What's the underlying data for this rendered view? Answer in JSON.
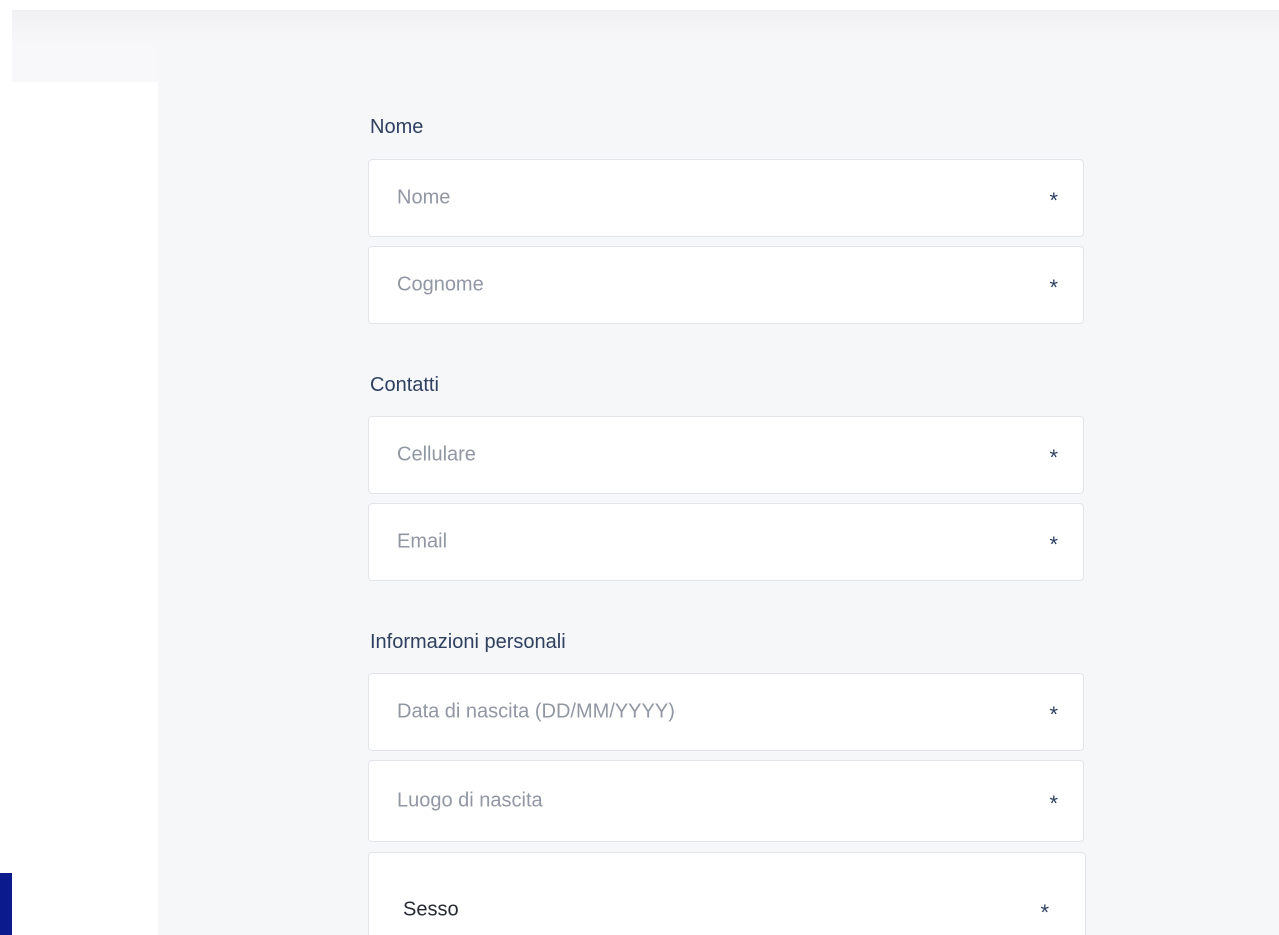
{
  "form": {
    "sections": {
      "nome": {
        "title": "Nome",
        "fields": {
          "nome": {
            "placeholder": "Nome",
            "required_mark": "*"
          },
          "cognome": {
            "placeholder": "Cognome",
            "required_mark": "*"
          }
        }
      },
      "contatti": {
        "title": "Contatti",
        "fields": {
          "cellulare": {
            "placeholder": "Cellulare",
            "required_mark": "*"
          },
          "email": {
            "placeholder": "Email",
            "required_mark": "*"
          }
        }
      },
      "informazioni": {
        "title": "Informazioni personali",
        "fields": {
          "data_nascita": {
            "placeholder": "Data di nascita (DD/MM/YYYY)",
            "required_mark": "*"
          },
          "luogo_nascita": {
            "placeholder": "Luogo di nascita",
            "required_mark": "*"
          },
          "sesso": {
            "label": "Sesso",
            "required_mark": "*"
          }
        }
      }
    }
  },
  "colors": {
    "accent_text": "#2e3f60",
    "placeholder_text": "#9197a3",
    "field_border": "#e2e4ea",
    "content_background": "#f6f7f9",
    "side_marker": "#0b1a8c"
  }
}
